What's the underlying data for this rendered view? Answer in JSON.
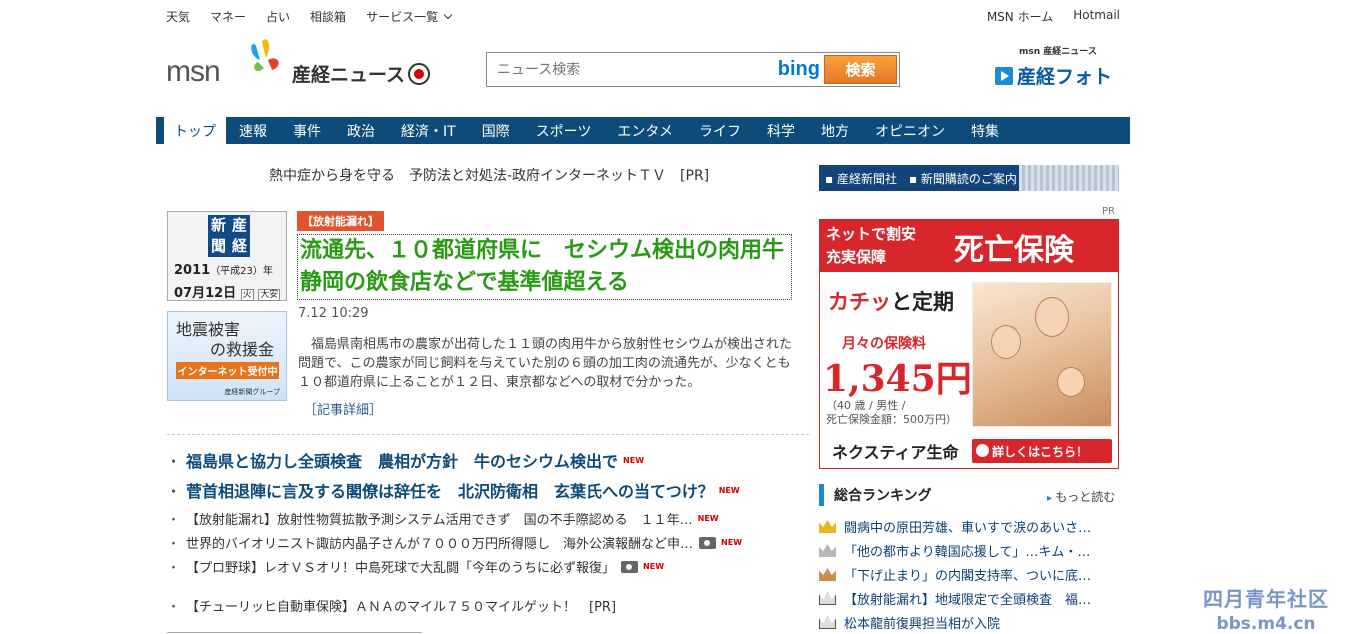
{
  "topnav": {
    "weather": "天気",
    "money": "マネー",
    "fortune": "占い",
    "advice": "相談箱",
    "services": "サービス一覧"
  },
  "toplinks": {
    "home": "MSN ホーム",
    "hotmail": "Hotmail"
  },
  "header": {
    "msn_logo": "msn",
    "sankei_logo": "産経ニュース",
    "search_placeholder": "ニュース検索",
    "bing": "bing",
    "search_button": "検索",
    "photo_small": "msn 産経ニュース",
    "photo_big": "産経フォト"
  },
  "nav": [
    "トップ",
    "速報",
    "事件",
    "政治",
    "経済・IT",
    "国際",
    "スポーツ",
    "エンタメ",
    "ライフ",
    "科学",
    "地方",
    "オピニオン",
    "特集"
  ],
  "pr_line": "熱中症から身を守る　予防法と対処法-政府インターネットＴＶ　[PR]",
  "datebox": {
    "paper": [
      "新",
      "産",
      "聞",
      "経"
    ],
    "year": "2011",
    "era": "（平成23）年",
    "date": "07月12日",
    "weekday": "火",
    "rokuyo": "大安"
  },
  "donation": {
    "line1": "地震被害",
    "line2": "の救援金",
    "button": "インターネット受付中",
    "group": "産経新聞グループ"
  },
  "main": {
    "tag": "【放射能漏れ】",
    "headline": "流通先、１０都道府県に　セシウム検出の肉用牛　静岡の飲食店などで基準値超える",
    "time": "7.12 10:29",
    "body": "福島県南相馬市の農家が出荷した１１頭の肉用牛から放射性セシウムが検出された問題で、この農家が同じ飼料を与えていた別の６頭の加工肉の流通先が、少なくとも１０都道府県に上ることが１２日、東京都などへの取材で分かった。",
    "detail": "［記事詳細］"
  },
  "big_items": [
    {
      "text": "福島県と協力し全頭検査　農相が方針　牛のセシウム検出で",
      "new": "NEW"
    },
    {
      "text": "菅首相退陣に言及する閣僚は辞任を　北沢防衛相　玄葉氏への当てつけ？",
      "new": "NEW"
    }
  ],
  "small_items": [
    {
      "text": "【放射能漏れ】放射性物質拡散予測システム活用できず　国の不手際認める　１１年…",
      "new": "NEW",
      "camera": false
    },
    {
      "text": "世界的バイオリニスト諏訪内晶子さんが７０００万円所得隠し　海外公演報酬など申…",
      "new": "NEW",
      "camera": true
    },
    {
      "text": "【プロ野球】レオＶＳオリ！中島死球で大乱闘「今年のうちに必ず報復」",
      "new": "NEW",
      "camera": true
    },
    {
      "text": "【チューリッヒ自動車保険】ＡＮＡのマイル７５０マイルゲット！　[PR]",
      "new": "",
      "camera": false
    }
  ],
  "right": {
    "banner_1": "産経新聞社",
    "banner_2": "新聞購読のご案内",
    "pr": "PR",
    "ad": {
      "t1": "ネットで割安",
      "t2": "充実保障",
      "t3": "死亡保険",
      "katchi_a": "カチッ",
      "katchi_b": "と定期",
      "fee": "月々の保険料",
      "price": "1,345円",
      "note1": "（40 歳 / 男性 /",
      "note2": "死亡保険金額：500万円）",
      "company": "ネクスティア生命",
      "more": "詳しくはこちら！"
    },
    "ranking_title": "総合ランキング",
    "ranking_more": "もっと読む",
    "ranking": [
      "闘病中の原田芳雄、車いすで涙のあいさ…",
      "「他の都市より韓国応援して」…キム・…",
      "「下げ止まり」の内閣支持率、ついに底…",
      "【放射能漏れ】地域限定で全頭検査　福…",
      "松本龍前復興担当相が入院"
    ],
    "crown_colors": [
      "#e9b51f",
      "#b8b8b8",
      "#c98d4e",
      "#dddddd",
      "#dddddd"
    ]
  },
  "watermark": {
    "line1": "四月青年社区",
    "line2": "bbs.m4.cn"
  }
}
